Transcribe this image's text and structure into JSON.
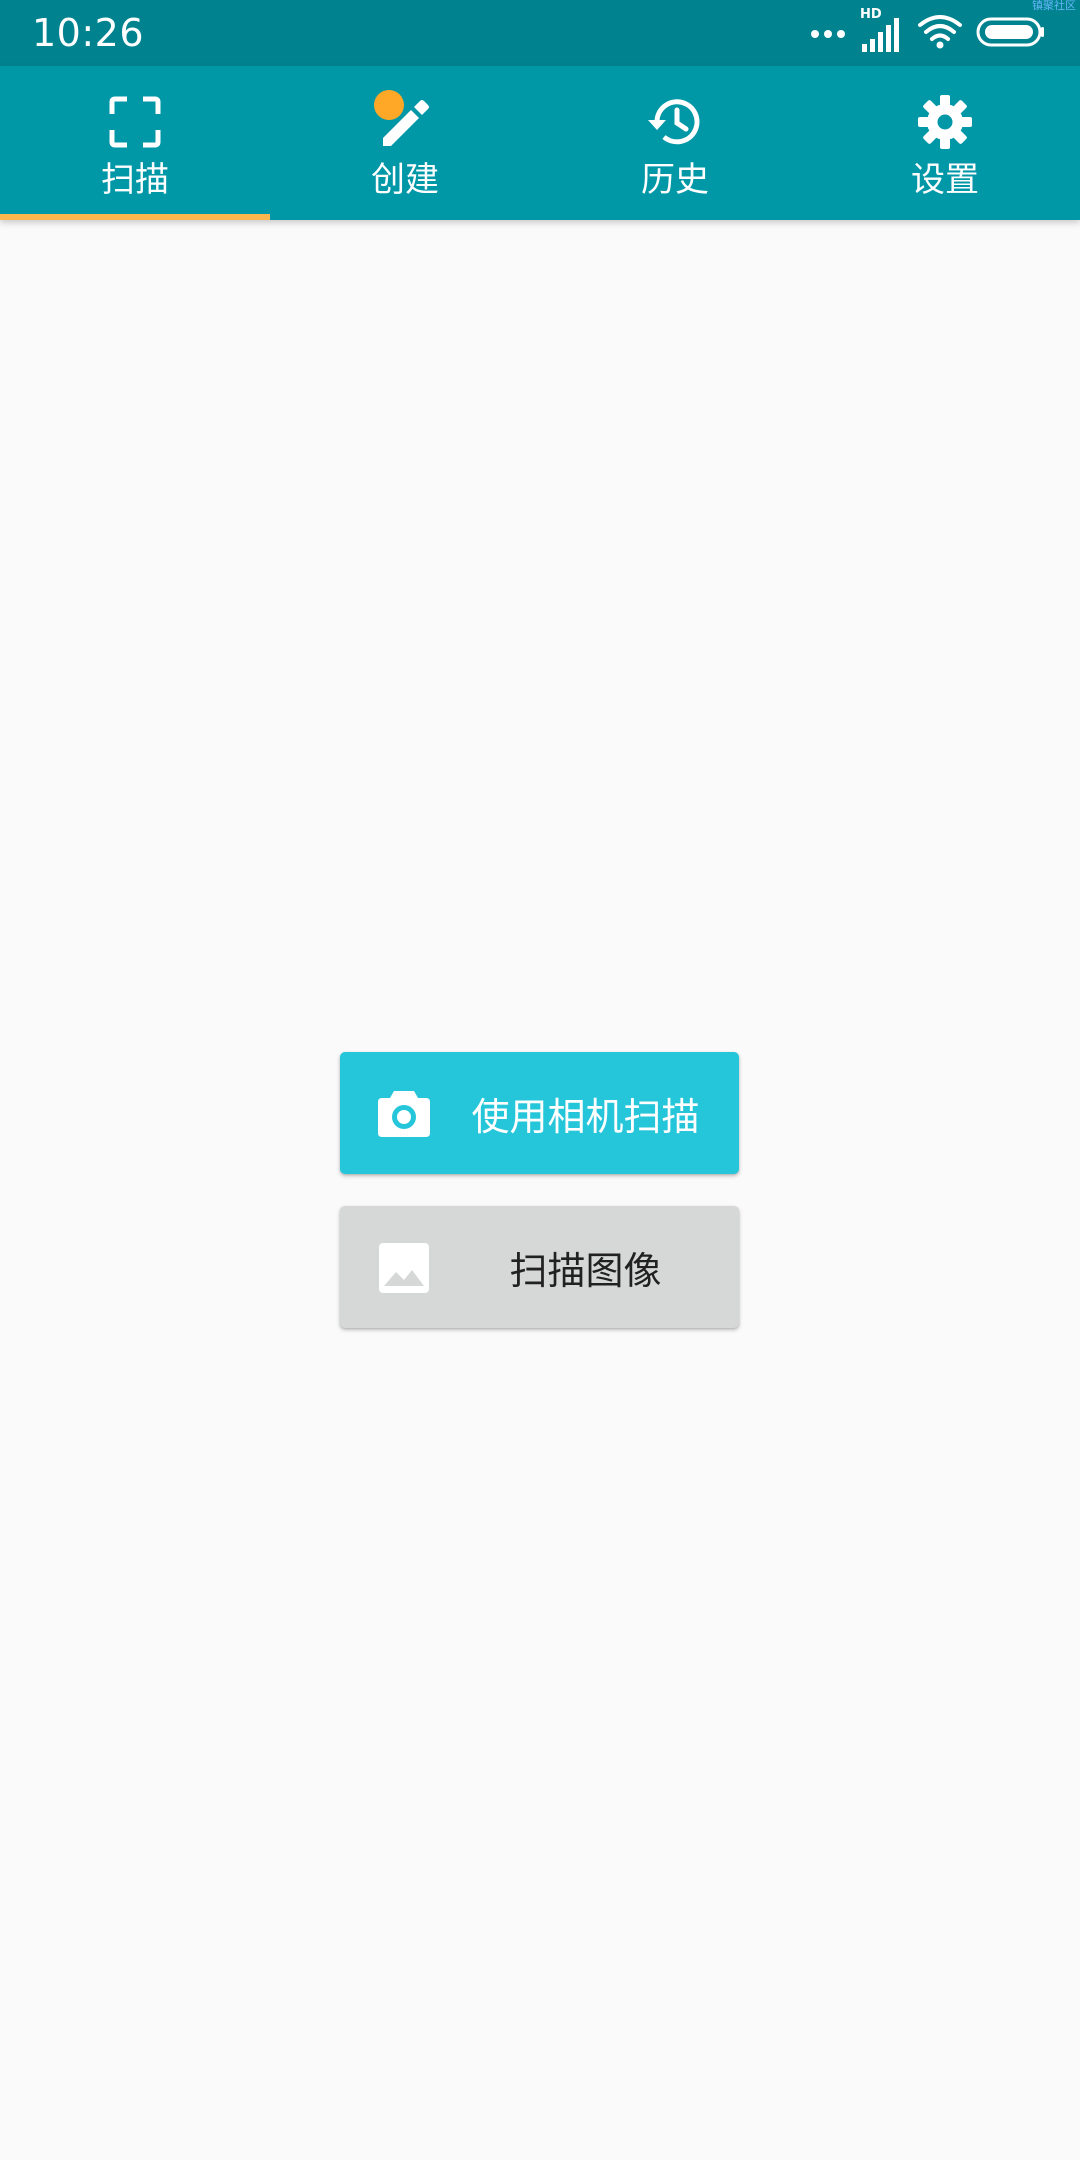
{
  "status_bar": {
    "time": "10:26",
    "signal_badge": "HD",
    "watermark": "镇聚社区",
    "icons": [
      "more-dots-icon",
      "signal-icon",
      "wifi-icon",
      "battery-icon"
    ]
  },
  "tabs": [
    {
      "label": "扫描",
      "icon": "scan-frame-icon",
      "selected": true
    },
    {
      "label": "创建",
      "icon": "pencil-icon",
      "selected": false,
      "badge": true
    },
    {
      "label": "历史",
      "icon": "history-icon",
      "selected": false
    },
    {
      "label": "设置",
      "icon": "gear-icon",
      "selected": false
    }
  ],
  "main": {
    "camera_button": {
      "label": "使用相机扫描",
      "icon": "camera-icon"
    },
    "image_button": {
      "label": "扫描图像",
      "icon": "image-icon"
    }
  },
  "colors": {
    "status_bar": "#00838f",
    "tab_bar": "#0097a7",
    "indicator": "#ffb74d",
    "badge": "#ffa726",
    "camera_button": "#26c6da",
    "image_button": "#d6d7d7",
    "background": "#fafafa"
  }
}
